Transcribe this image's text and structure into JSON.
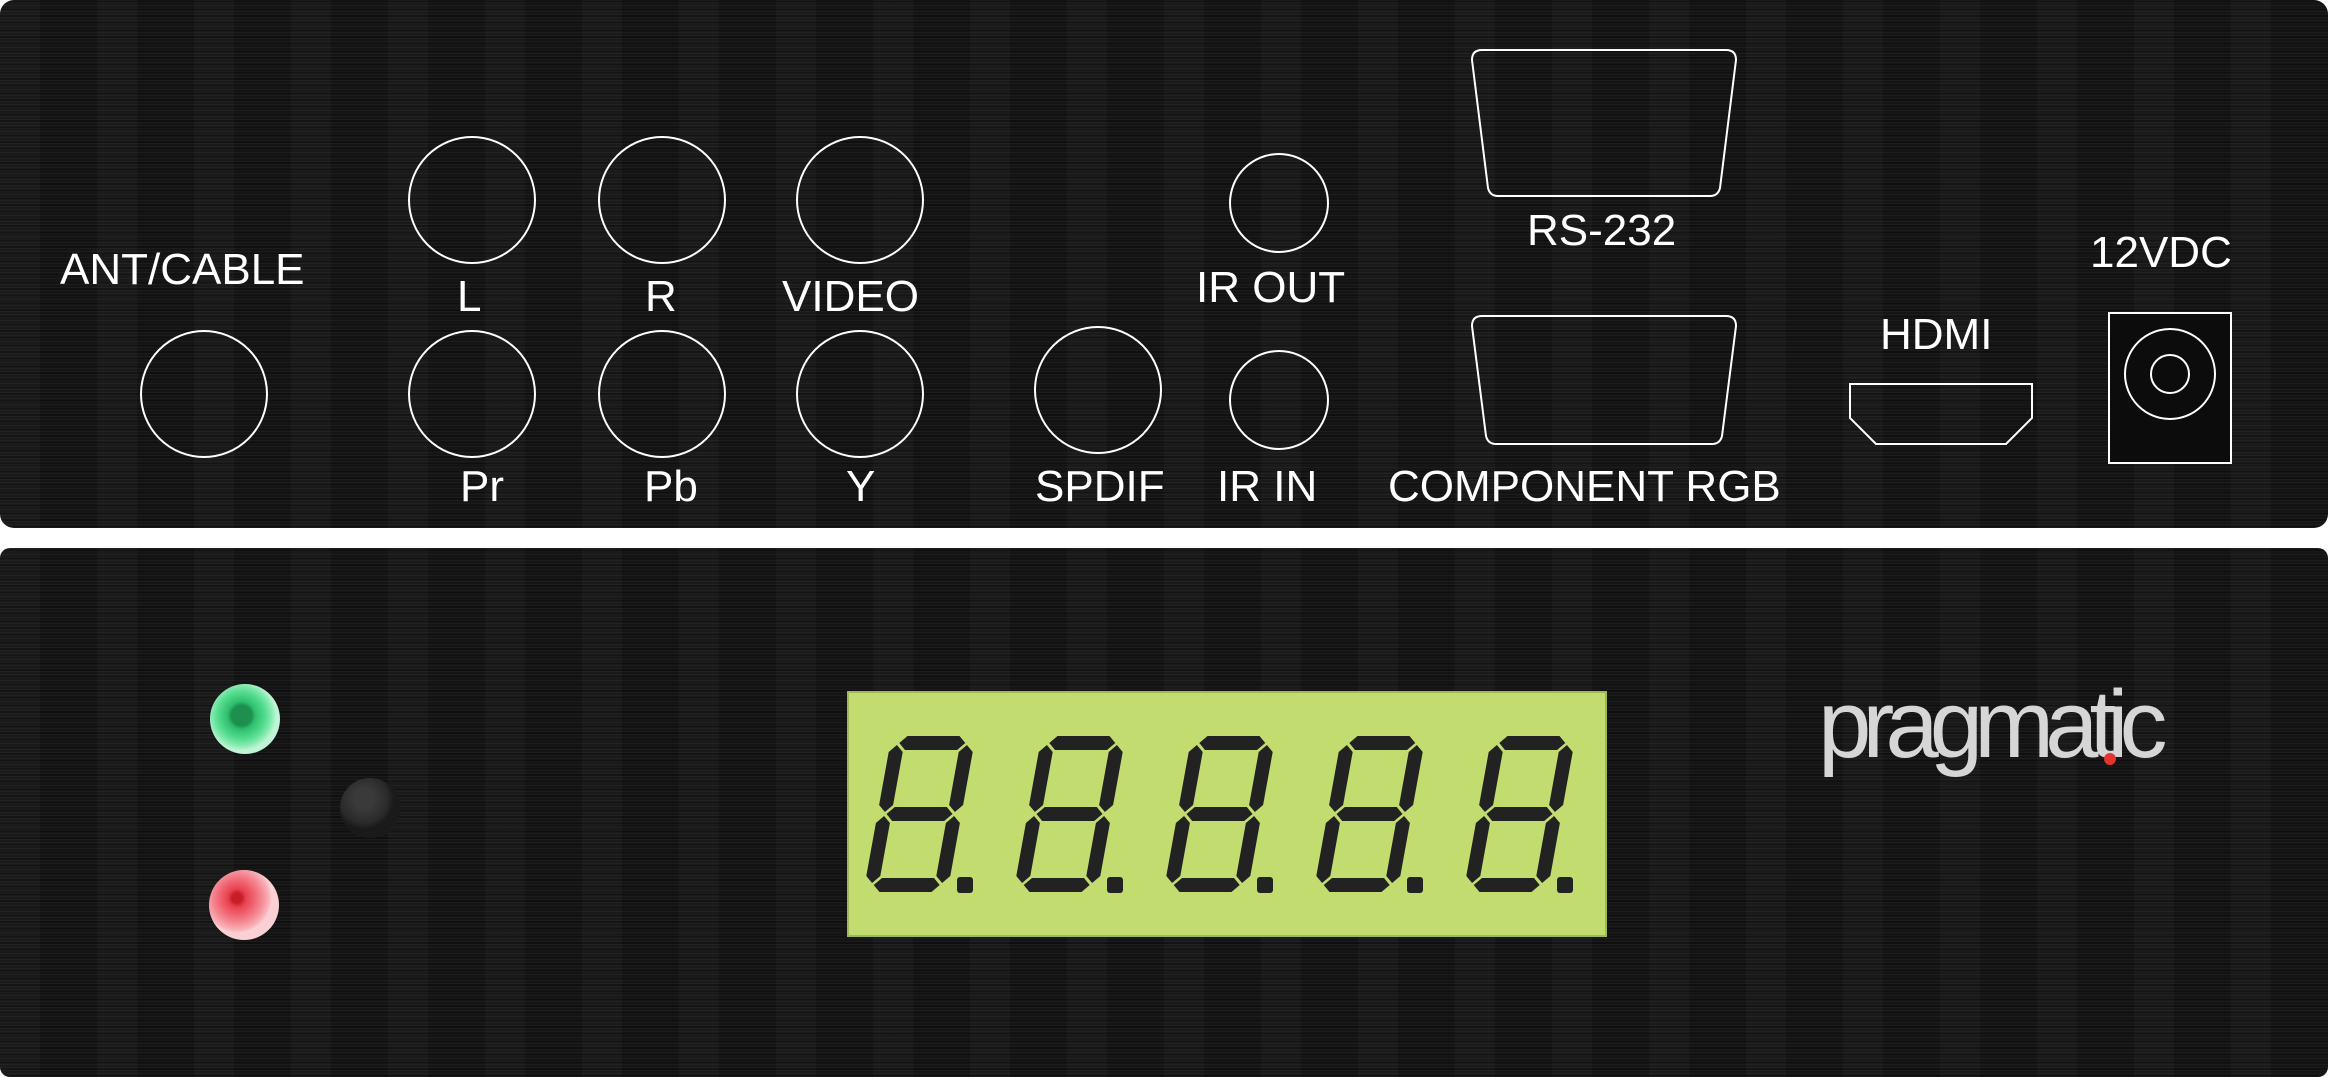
{
  "rear_panel": {
    "labels": {
      "ant_cable": "ANT/CABLE",
      "audio_l": "L",
      "audio_r": "R",
      "video": "VIDEO",
      "ir_out": "IR OUT",
      "rs232": "RS-232",
      "power": "12VDC",
      "pr": "Pr",
      "pb": "Pb",
      "y": "Y",
      "spdif": "SPDIF",
      "ir_in": "IR IN",
      "component_rgb": "COMPONENT RGB",
      "hdmi": "HDMI"
    }
  },
  "front_panel": {
    "display_digits": [
      "8.",
      "8.",
      "8.",
      "8.",
      "8."
    ],
    "brand": "pragmatic",
    "colors": {
      "lcd_background": "#c2dc6f",
      "segment": "#222222",
      "power_led": "#2fbf6e",
      "standby_led": "#e8414e",
      "brand_dot": "#e2352f"
    },
    "icons": [
      "power-led-green",
      "standby-led-red",
      "front-push-button"
    ]
  }
}
